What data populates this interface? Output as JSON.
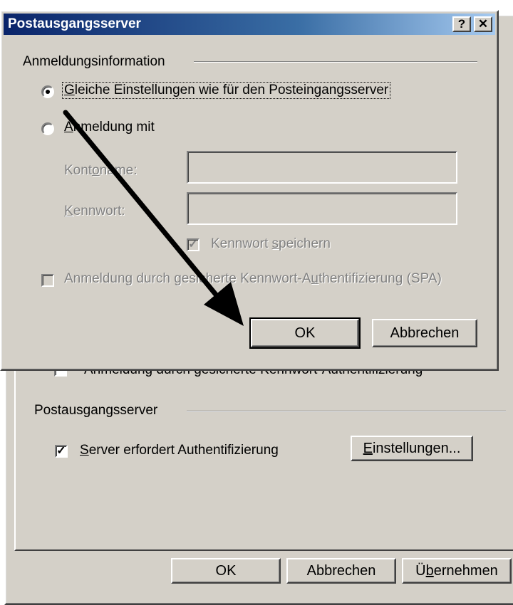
{
  "back_dialog": {
    "covered_checkbox_label": "Anmeldung durch gesicherte Kennwort-Authentifizierung",
    "group_title": "Postausgangsserver",
    "auth_checkbox_label_pre": "",
    "auth_checkbox_label_u": "S",
    "auth_checkbox_label_post": "erver erfordert Authentifizierung",
    "auth_checked": true,
    "settings_button_u": "E",
    "settings_button_rest": "instellungen...",
    "ok_label": "OK",
    "cancel_label": "Abbrechen",
    "apply_pre": "Ü",
    "apply_u": "b",
    "apply_post": "ernehmen"
  },
  "dialog": {
    "title": "Postausgangsserver",
    "help_glyph": "?",
    "close_glyph": "✕",
    "group_title": "Anmeldungsinformation",
    "radio_same_u": "G",
    "radio_same_rest": "leiche Einstellungen wie für den Posteingangsserver",
    "radio_login_u": "A",
    "radio_login_rest": "nmeldung mit",
    "account_pre": "Kont",
    "account_u": "o",
    "account_post": "name:",
    "password_u": "K",
    "password_rest": "ennwort:",
    "save_pw_pre": "Kennwort ",
    "save_pw_u": "s",
    "save_pw_post": "peichern",
    "spa_pre": "Anmeldung durch gesicherte Kennwort-A",
    "spa_u": "u",
    "spa_post": "thentifizierung (SPA)",
    "ok_label": "OK",
    "cancel_label": "Abbrechen",
    "selected_option": "same-as-incoming",
    "save_pw_checked": true,
    "spa_checked": false
  },
  "annotation": {
    "arrow_color": "#000000"
  },
  "colors": {
    "face": "#d4d0c8",
    "title_start": "#0a246a",
    "title_end": "#a6caf0",
    "disabled_text": "#808080"
  }
}
